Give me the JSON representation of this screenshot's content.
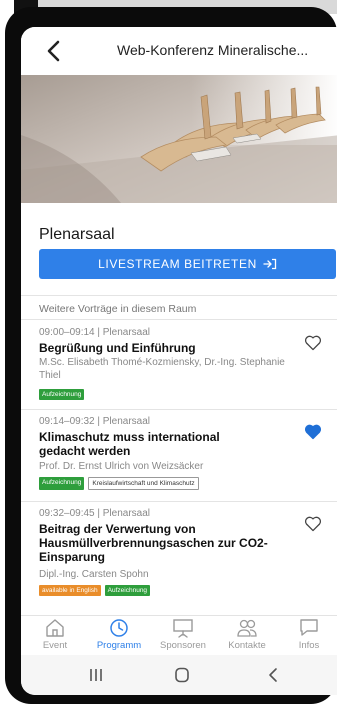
{
  "app_title": "Web-Konferenz Mineralische...",
  "room_name": "Plenarsaal",
  "livestream_button": "LIVESTREAM BEITRETEN",
  "section_header": "Weitere Vorträge in diesem Raum",
  "talks": [
    {
      "time": "09:00–09:14 | Plenarsaal",
      "title": "Begrüßung und Einführung",
      "speaker": "M.Sc. Elisabeth Thomé-Kozmiensky, Dr.-Ing. Stephanie Thiel",
      "tags": [
        "Aufzeichnung"
      ],
      "favorite": false
    },
    {
      "time": "09:14–09:32 | Plenarsaal",
      "title": "Klimaschutz muss international gedacht werden",
      "speaker": "Prof. Dr. Ernst Ulrich von Weizsäcker",
      "tags": [
        "Aufzeichnung",
        "Kreislaufwirtschaft und Klimaschutz"
      ],
      "favorite": true
    },
    {
      "time": "09:32–09:45 | Plenarsaal",
      "title": "Beitrag der Verwertung von Hausmüllverbrennungsaschen zur CO2-Einsparung",
      "speaker": "Dipl.-Ing. Carsten Spohn",
      "tags": [
        "available in English",
        "Aufzeichnung"
      ],
      "favorite": false
    }
  ],
  "nav": [
    {
      "label": "Event",
      "icon": "home-icon"
    },
    {
      "label": "Programm",
      "icon": "clock-icon"
    },
    {
      "label": "Sponsoren",
      "icon": "presentation-icon"
    },
    {
      "label": "Kontakte",
      "icon": "people-icon"
    },
    {
      "label": "Infos",
      "icon": "chat-icon"
    }
  ],
  "active_nav": "Programm",
  "colors": {
    "accent": "#2f80e8",
    "tag_green": "#2e9e3c",
    "tag_orange": "#e98d2a",
    "favorite": "#1f6fd6"
  }
}
